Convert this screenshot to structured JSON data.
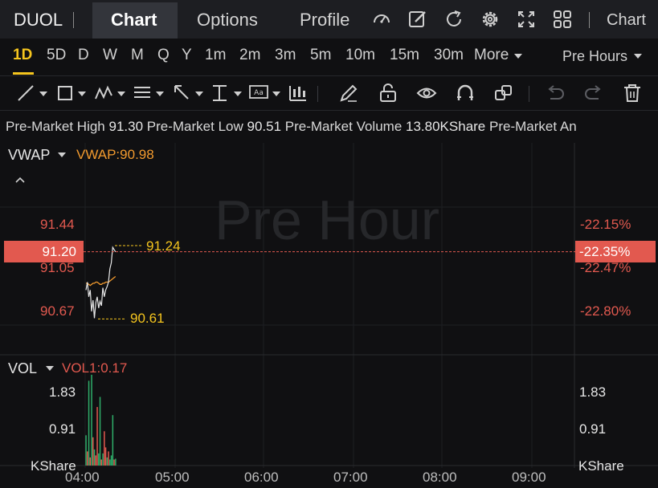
{
  "header": {
    "ticker": "DUOL",
    "tabs": [
      "Chart",
      "Options",
      "Profile"
    ],
    "right_label": "Chart"
  },
  "periods": {
    "items": [
      "1D",
      "5D",
      "D",
      "W",
      "M",
      "Q",
      "Y",
      "1m",
      "2m",
      "3m",
      "5m",
      "10m",
      "15m",
      "30m",
      "More"
    ],
    "active": "1D",
    "session": "Pre Hours"
  },
  "info": {
    "high_label": "Pre-Market High",
    "high": "91.30",
    "low_label": "Pre-Market Low",
    "low": "90.51",
    "volume_label": "Pre-Market Volume",
    "volume": "13.80KShare",
    "more_label": "Pre-Market An"
  },
  "price_panel": {
    "indicator": "VWAP",
    "indicator_value": "VWAP:90.98",
    "watermark": "Pre Hour",
    "left_ticks": [
      "91.44",
      "91.05",
      "90.67"
    ],
    "right_ticks": [
      "-22.15%",
      "-22.47%",
      "-22.80%"
    ],
    "current_price": "91.20",
    "current_pct": "-22.35%",
    "high_marker": "91.24",
    "low_marker": "90.61"
  },
  "volume_panel": {
    "indicator": "VOL",
    "indicator_value": "VOL1:0.17",
    "left_ticks": [
      "1.83",
      "0.91"
    ],
    "right_ticks": [
      "1.83",
      "0.91"
    ],
    "unit_left": "KShare",
    "unit_right": "KShare"
  },
  "time_axis": [
    "04:00",
    "05:00",
    "06:00",
    "07:00",
    "08:00",
    "09:00"
  ],
  "colors": {
    "up": "#2fae6a",
    "down": "#e2594f",
    "accent": "#f5c51e",
    "vwap": "#f29a2e",
    "price_line": "#e8e8e8"
  },
  "chart_data": [
    {
      "type": "line",
      "x": [
        "04:00",
        "04:01",
        "04:02",
        "04:03",
        "04:04",
        "04:05",
        "04:06",
        "04:07",
        "04:08",
        "04:09",
        "04:10",
        "04:11",
        "04:12",
        "04:13",
        "04:14",
        "04:15",
        "04:16",
        "04:17",
        "04:18",
        "04:19",
        "04:20",
        "04:21"
      ],
      "series": [
        {
          "name": "VWAP",
          "values": [
            90.92,
            90.92,
            90.91,
            90.9,
            90.91,
            90.92,
            90.92,
            90.93,
            90.93,
            90.92,
            90.91,
            90.91,
            90.92,
            90.92,
            90.93,
            90.93,
            90.93,
            90.94,
            90.95,
            90.96,
            90.97,
            90.98
          ]
        },
        {
          "values": [
            90.86,
            90.93,
            90.8,
            90.86,
            90.67,
            90.77,
            90.61,
            90.75,
            90.8,
            90.7,
            90.76,
            90.72,
            90.88,
            90.8,
            90.86,
            90.89,
            90.93,
            91.05,
            91.1,
            91.24,
            91.22,
            91.2
          ]
        }
      ],
      "ylim": [
        90.6,
        91.3
      ]
    },
    {
      "type": "bar",
      "x": [
        "04:00",
        "04:01",
        "04:02",
        "04:03",
        "04:04",
        "04:05",
        "04:06",
        "04:07",
        "04:08",
        "04:09",
        "04:10",
        "04:11",
        "04:12",
        "04:13",
        "04:14",
        "04:15",
        "04:16",
        "04:17",
        "04:18",
        "04:19",
        "04:20",
        "04:21"
      ],
      "values": [
        0.75,
        0.35,
        2.1,
        0.2,
        2.25,
        0.7,
        0.4,
        0.25,
        1.45,
        0.3,
        1.7,
        0.15,
        0.3,
        0.85,
        0.45,
        0.2,
        0.35,
        0.15,
        0.25,
        1.25,
        0.15,
        0.17
      ],
      "up": [
        true,
        false,
        true,
        false,
        true,
        false,
        true,
        false,
        false,
        true,
        true,
        false,
        true,
        false,
        false,
        true,
        false,
        true,
        true,
        true,
        false,
        true
      ],
      "ylim": [
        0,
        2.3
      ]
    }
  ]
}
